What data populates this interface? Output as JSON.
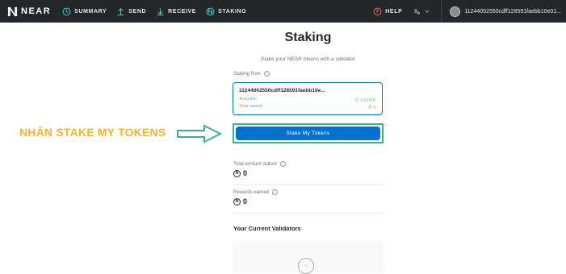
{
  "topbar": {
    "logo_text": "NEAR",
    "nav": [
      {
        "label": "SUMMARY"
      },
      {
        "label": "SEND"
      },
      {
        "label": "RECEIVE"
      },
      {
        "label": "STAKING"
      }
    ],
    "help_label": "HELP",
    "account_id": "11244002550cdff128591faebb10e01..."
  },
  "main": {
    "title": "Staking",
    "subtitle": "Stake your NEAR tokens with a validator",
    "staking_from_label": "Staking from",
    "account_box": {
      "account_id": "11244002550cdff128591faebb10e...",
      "available_label": "Available",
      "available_value": "Ⓝ 3.01991",
      "total_staked_label": "Total staked",
      "total_staked_value": "Ⓝ 0"
    },
    "stake_button_label": "Stake My Tokens",
    "total_staked_label": "Total amount staked",
    "total_staked_value": "0",
    "rewards_label": "Rewards earned",
    "rewards_value": "0",
    "validators_title": "Your Current Validators"
  },
  "annotation": {
    "text": "NHẤN STAKE MY TOKENS"
  },
  "colors": {
    "topbar": "#24272a",
    "accent_blue": "#0072ce",
    "highlight_green": "#3ab28e",
    "annotation_yellow": "#f2b233",
    "available_green": "#5ace84"
  }
}
